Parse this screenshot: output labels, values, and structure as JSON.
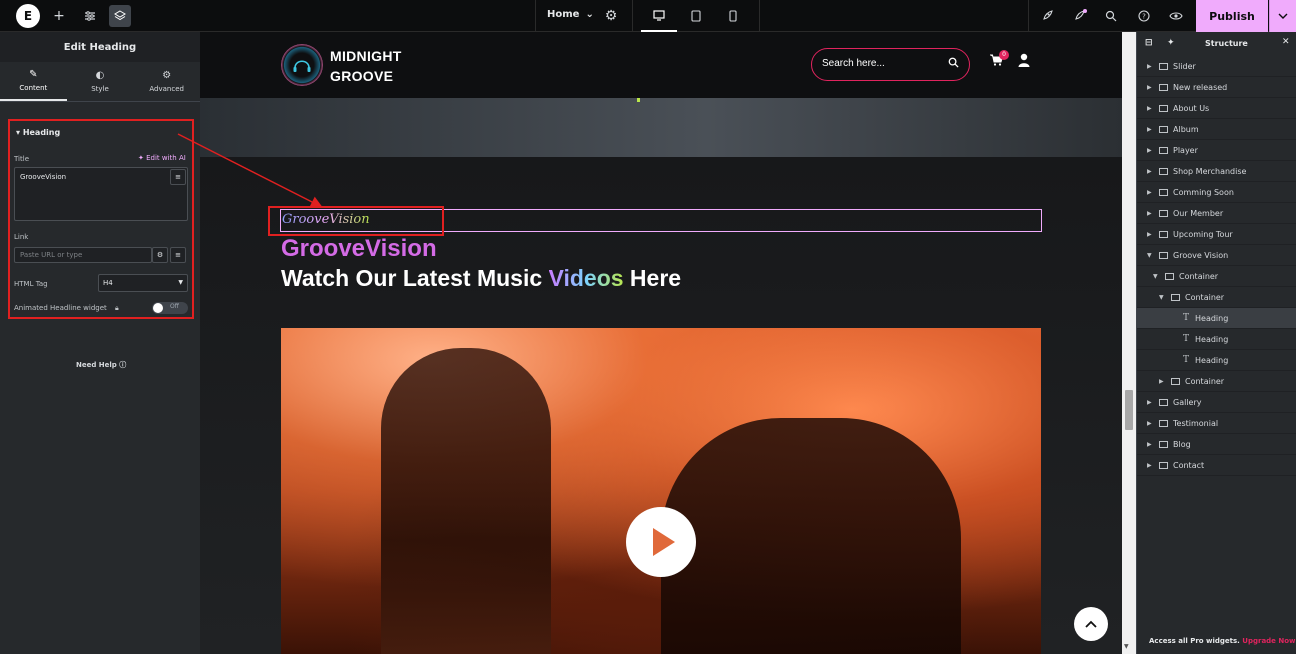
{
  "topbar": {
    "logo_letter": "E",
    "page_name": "Home",
    "publish_label": "Publish"
  },
  "left_panel": {
    "title": "Edit Heading",
    "tabs": [
      {
        "label": "Content",
        "icon": "pencil-icon"
      },
      {
        "label": "Style",
        "icon": "half-circle-icon"
      },
      {
        "label": "Advanced",
        "icon": "gear-icon"
      }
    ],
    "section_title": "Heading",
    "title_label": "Title",
    "edit_ai_label": "Edit with AI",
    "title_value": "GrooveVision",
    "link_label": "Link",
    "link_placeholder": "Paste URL or type",
    "html_tag_label": "HTML Tag",
    "html_tag_value": "H4",
    "animated_label": "Animated Headline widget",
    "toggle_state": "Off",
    "need_help": "Need Help"
  },
  "site": {
    "logo_line1": "MIDNIGHT",
    "logo_line2": "GROOVE",
    "search_placeholder": "Search here...",
    "cart_count": "0",
    "heading_script": "GrooveVision",
    "heading_sub": "GrooveVision",
    "heading_main_pre": "Watch Our Latest Music",
    "heading_main_accent": "Videos",
    "heading_main_post": "Here"
  },
  "structure": {
    "title": "Structure",
    "items": [
      {
        "label": "Slider",
        "level": 0,
        "kind": "container",
        "expanded": false
      },
      {
        "label": "New released",
        "level": 0,
        "kind": "container",
        "expanded": false
      },
      {
        "label": "About Us",
        "level": 0,
        "kind": "container",
        "expanded": false
      },
      {
        "label": "Album",
        "level": 0,
        "kind": "container",
        "expanded": false
      },
      {
        "label": "Player",
        "level": 0,
        "kind": "container",
        "expanded": false
      },
      {
        "label": "Shop Merchandise",
        "level": 0,
        "kind": "container",
        "expanded": false
      },
      {
        "label": "Comming Soon",
        "level": 0,
        "kind": "container",
        "expanded": false
      },
      {
        "label": "Our Member",
        "level": 0,
        "kind": "container",
        "expanded": false
      },
      {
        "label": "Upcoming Tour",
        "level": 0,
        "kind": "container",
        "expanded": false
      },
      {
        "label": "Groove Vision",
        "level": 0,
        "kind": "container",
        "expanded": true
      },
      {
        "label": "Container",
        "level": 1,
        "kind": "container",
        "expanded": true
      },
      {
        "label": "Container",
        "level": 2,
        "kind": "container",
        "expanded": true
      },
      {
        "label": "Heading",
        "level": 3,
        "kind": "heading",
        "active": true
      },
      {
        "label": "Heading",
        "level": 3,
        "kind": "heading"
      },
      {
        "label": "Heading",
        "level": 3,
        "kind": "heading"
      },
      {
        "label": "Container",
        "level": 2,
        "kind": "container",
        "expanded": false
      },
      {
        "label": "Gallery",
        "level": 0,
        "kind": "container",
        "expanded": false
      },
      {
        "label": "Testimonial",
        "level": 0,
        "kind": "container",
        "expanded": false
      },
      {
        "label": "Blog",
        "level": 0,
        "kind": "container",
        "expanded": false
      },
      {
        "label": "Contact",
        "level": 0,
        "kind": "container",
        "expanded": false
      }
    ],
    "footer_text": "Access all Pro widgets.",
    "footer_link": "Upgrade Now"
  },
  "colors": {
    "accent_pink": "#f0abfc",
    "highlight_red": "#e02020",
    "brand_magenta": "#e0245e"
  }
}
